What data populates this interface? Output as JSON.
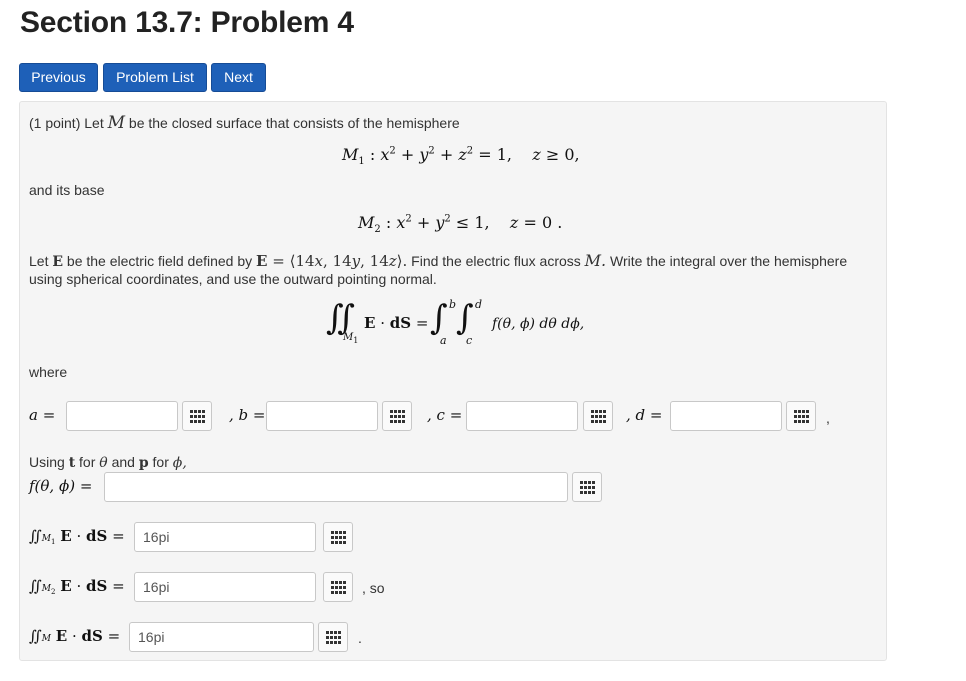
{
  "page_title": "Section 13.7: Problem 4",
  "nav": {
    "previous": "Previous",
    "problem_list": "Problem List",
    "next": "Next"
  },
  "problem": {
    "points": "(1 point)",
    "intro": "Let",
    "intro_var": "M",
    "intro_rest": "be the closed surface that consists of the hemisphere",
    "eq1": "M₁ : x² + y² + z² = 1,   z ≥ 0,",
    "and_base": "and its base",
    "eq2": "M₂ : x² + y² ≤ 1,   z = 0 .",
    "line3a": "Let",
    "line3_E": "E",
    "line3b": "be the electric field defined by",
    "line3_def": "E = ⟨14x, 14y, 14z⟩.",
    "line3c": "Find the electric flux across",
    "line3_M": "M.",
    "line3d": "Write the integral over the hemisphere",
    "line4": "using spherical coordinates, and use the outward pointing normal.",
    "where": "where",
    "using_prefix": "Using",
    "using_t": "t",
    "using_for": "for",
    "using_theta": "θ",
    "using_and": "and",
    "using_p": "p",
    "using_for2": "for",
    "using_phi": "ϕ,",
    "f_label": "f(θ, ϕ) =",
    "so": ", so",
    "period": ".",
    "comma": ","
  },
  "answers": {
    "a": "",
    "b": "",
    "c": "",
    "d": "",
    "f": "",
    "flux_m1": "16pi",
    "flux_m2": "16pi",
    "flux_m": "16pi"
  },
  "labels": {
    "a": "a =",
    "b": ", b =",
    "c": ", c =",
    "d": ", d ="
  },
  "icons": {
    "math_editor": "grid-icon"
  },
  "colors": {
    "nav_button": "#1e60b8",
    "panel_bg": "#f5f5f5"
  }
}
